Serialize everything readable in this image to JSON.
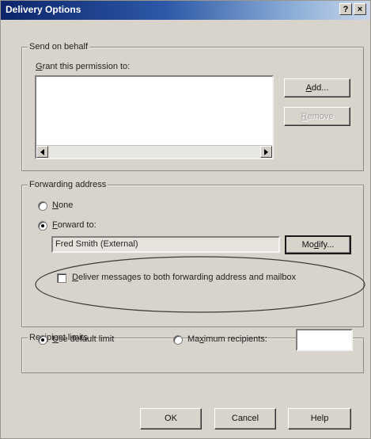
{
  "window": {
    "title": "Delivery Options",
    "help_button": "?",
    "close_button": "×"
  },
  "send_on_behalf": {
    "legend": "Send on behalf",
    "grant_label_key": "G",
    "grant_label_rest": "rant this permission to:",
    "add_button_key": "A",
    "add_button_rest": "dd...",
    "remove_button_key": "R",
    "remove_button_rest": "emove"
  },
  "forwarding": {
    "legend": "Forwarding address",
    "none_key": "N",
    "none_rest": "one",
    "none_selected": false,
    "forward_key": "F",
    "forward_rest": "orward to:",
    "forward_selected": true,
    "forward_value": "Fred Smith (External)",
    "modify_button_pre": "Mo",
    "modify_button_key": "d",
    "modify_button_post": "ify...",
    "deliver_both_key": "D",
    "deliver_both_rest": "eliver messages to both forwarding address and mailbox",
    "deliver_both_checked": false
  },
  "recipient_limits": {
    "legend": "Recipient limits",
    "default_key": "U",
    "default_rest": "se default limit",
    "default_selected": true,
    "maximum_pre": "Ma",
    "maximum_key": "x",
    "maximum_post": "imum recipients:",
    "maximum_selected": false,
    "maximum_value": ""
  },
  "footer": {
    "ok": "OK",
    "cancel": "Cancel",
    "help": "Help"
  },
  "colors": {
    "dialog_face": "#d8d4cc",
    "titlebar_start": "#0b246a",
    "annotation_ellipse": "#3a3a3a"
  }
}
